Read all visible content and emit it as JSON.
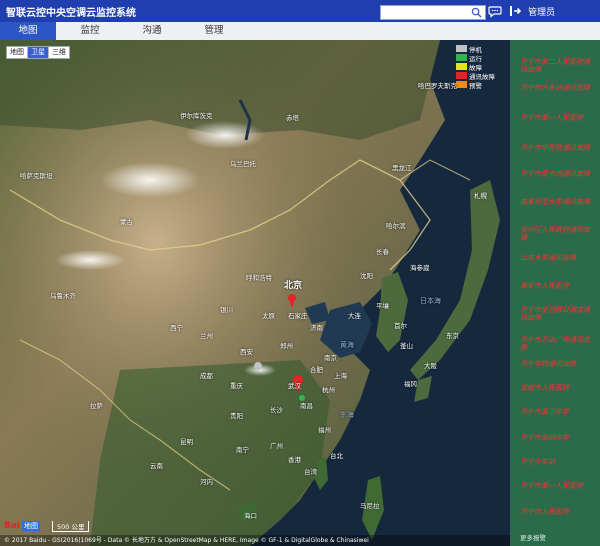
{
  "app": {
    "title": "智联云控中央空调云监控系统",
    "user": "管理员"
  },
  "search": {
    "placeholder": ""
  },
  "tabs": [
    {
      "label": "地图",
      "active": true
    },
    {
      "label": "监控",
      "active": false
    },
    {
      "label": "沟通",
      "active": false
    },
    {
      "label": "管理",
      "active": false
    }
  ],
  "map": {
    "types": [
      "地图",
      "卫星",
      "三维"
    ],
    "selected_type": "卫星",
    "legend": [
      {
        "label": "停机",
        "color": "#bfc3c7"
      },
      {
        "label": "运行",
        "color": "#2db84a"
      },
      {
        "label": "故障",
        "color": "#e8e31e"
      },
      {
        "label": "通讯故障",
        "color": "#e22525"
      },
      {
        "label": "预警",
        "color": "#f08a1c"
      }
    ],
    "labels": {
      "beijing": "北京",
      "heilongjiang": "黑龙江",
      "mongolia": "蒙古",
      "ulaanbaatar": "乌兰巴托",
      "irkutsk": "伊尔库茨克",
      "chita": "赤塔",
      "harbin": "哈尔滨",
      "changchun": "长春",
      "shenyang": "沈阳",
      "dalian": "大连",
      "seoul": "首尔",
      "pyongyang": "平壤",
      "tokyo": "东京",
      "japan_sea": "日本海",
      "yellow_sea": "黄海",
      "east_china_sea": "东海",
      "hohhot": "呼和浩特",
      "taiyuan": "太原",
      "shijiazhuang": "石家庄",
      "jinan": "济南",
      "zhengzhou": "郑州",
      "xian": "西安",
      "lanzhou": "兰州",
      "xining": "西宁",
      "yinchuan": "银川",
      "wuhan": "武汉",
      "hefei": "合肥",
      "nanjing": "南京",
      "shanghai": "上海",
      "hangzhou": "杭州",
      "changsha": "长沙",
      "nanchang": "南昌",
      "fuzhou": "福州",
      "taibei": "台北",
      "chongqing": "重庆",
      "chengdu": "成都",
      "guiyang": "贵阳",
      "kunming": "昆明",
      "nanning": "南宁",
      "guangzhou": "广州",
      "hongkong": "香港",
      "haikou": "海口",
      "hanoi": "河内",
      "manila": "马尼拉",
      "taiwan": "台湾",
      "yunnan": "云南",
      "lhasa": "拉萨",
      "urumqi": "乌鲁木齐",
      "kazakhstan": "哈萨克斯坦",
      "sapporo": "札幌",
      "osaka": "大阪",
      "fukuoka": "福冈",
      "busan": "釜山",
      "vladivostok": "海参崴",
      "khabarovsk": "哈巴罗夫斯克"
    },
    "copyright": "© 2017 Baidu - GS(2016)1069号 - Data © 长地万方 & OpenStreetMap & HERE, Image © GF-1 & DigitalGlobe & Chinasiwei",
    "scale": "500 公里",
    "baidu_logo": "Bai",
    "baidu_logo_tag": "地图"
  },
  "alerts": [
    "济宁市第二人民医院通讯故障",
    "济宁市汽车站通讯故障",
    "济宁市第一人民医院",
    "济宁市中医院通讯故障",
    "济宁市图书馆通讯故障",
    "曲阜师范大学通讯故障",
    "兖州区人民政府通讯故障",
    "山东大学通讯故障",
    "泰安市人民医院",
    "济宁市皇冠假日酒店通讯故障",
    "济宁市万达广场通讯故障",
    "济宁学院通讯故障",
    "邹城市人民医院",
    "济宁市第三中学",
    "济宁市第四中学",
    "济宁火车站",
    "济宁市第一人民医院",
    "济宁市人民医院"
  ],
  "alerts_footer": "更多报警"
}
